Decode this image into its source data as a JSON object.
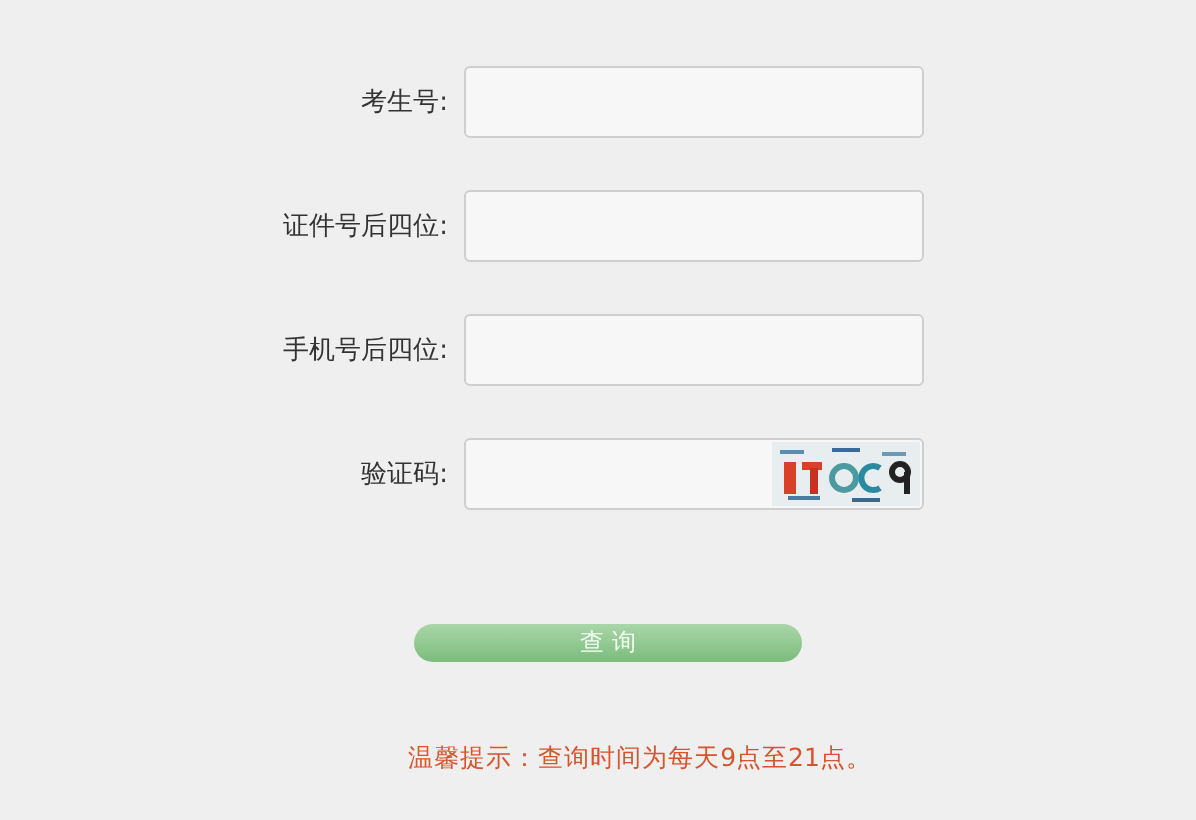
{
  "form": {
    "fields": [
      {
        "label": "考生号:",
        "kind": "text"
      },
      {
        "label": "证件号后四位:",
        "kind": "text"
      },
      {
        "label": "手机号后四位:",
        "kind": "text"
      },
      {
        "label": "验证码:",
        "kind": "captcha"
      }
    ]
  },
  "submit_button": "查 询",
  "notice": "温馨提示：查询时间为每天9点至21点。"
}
